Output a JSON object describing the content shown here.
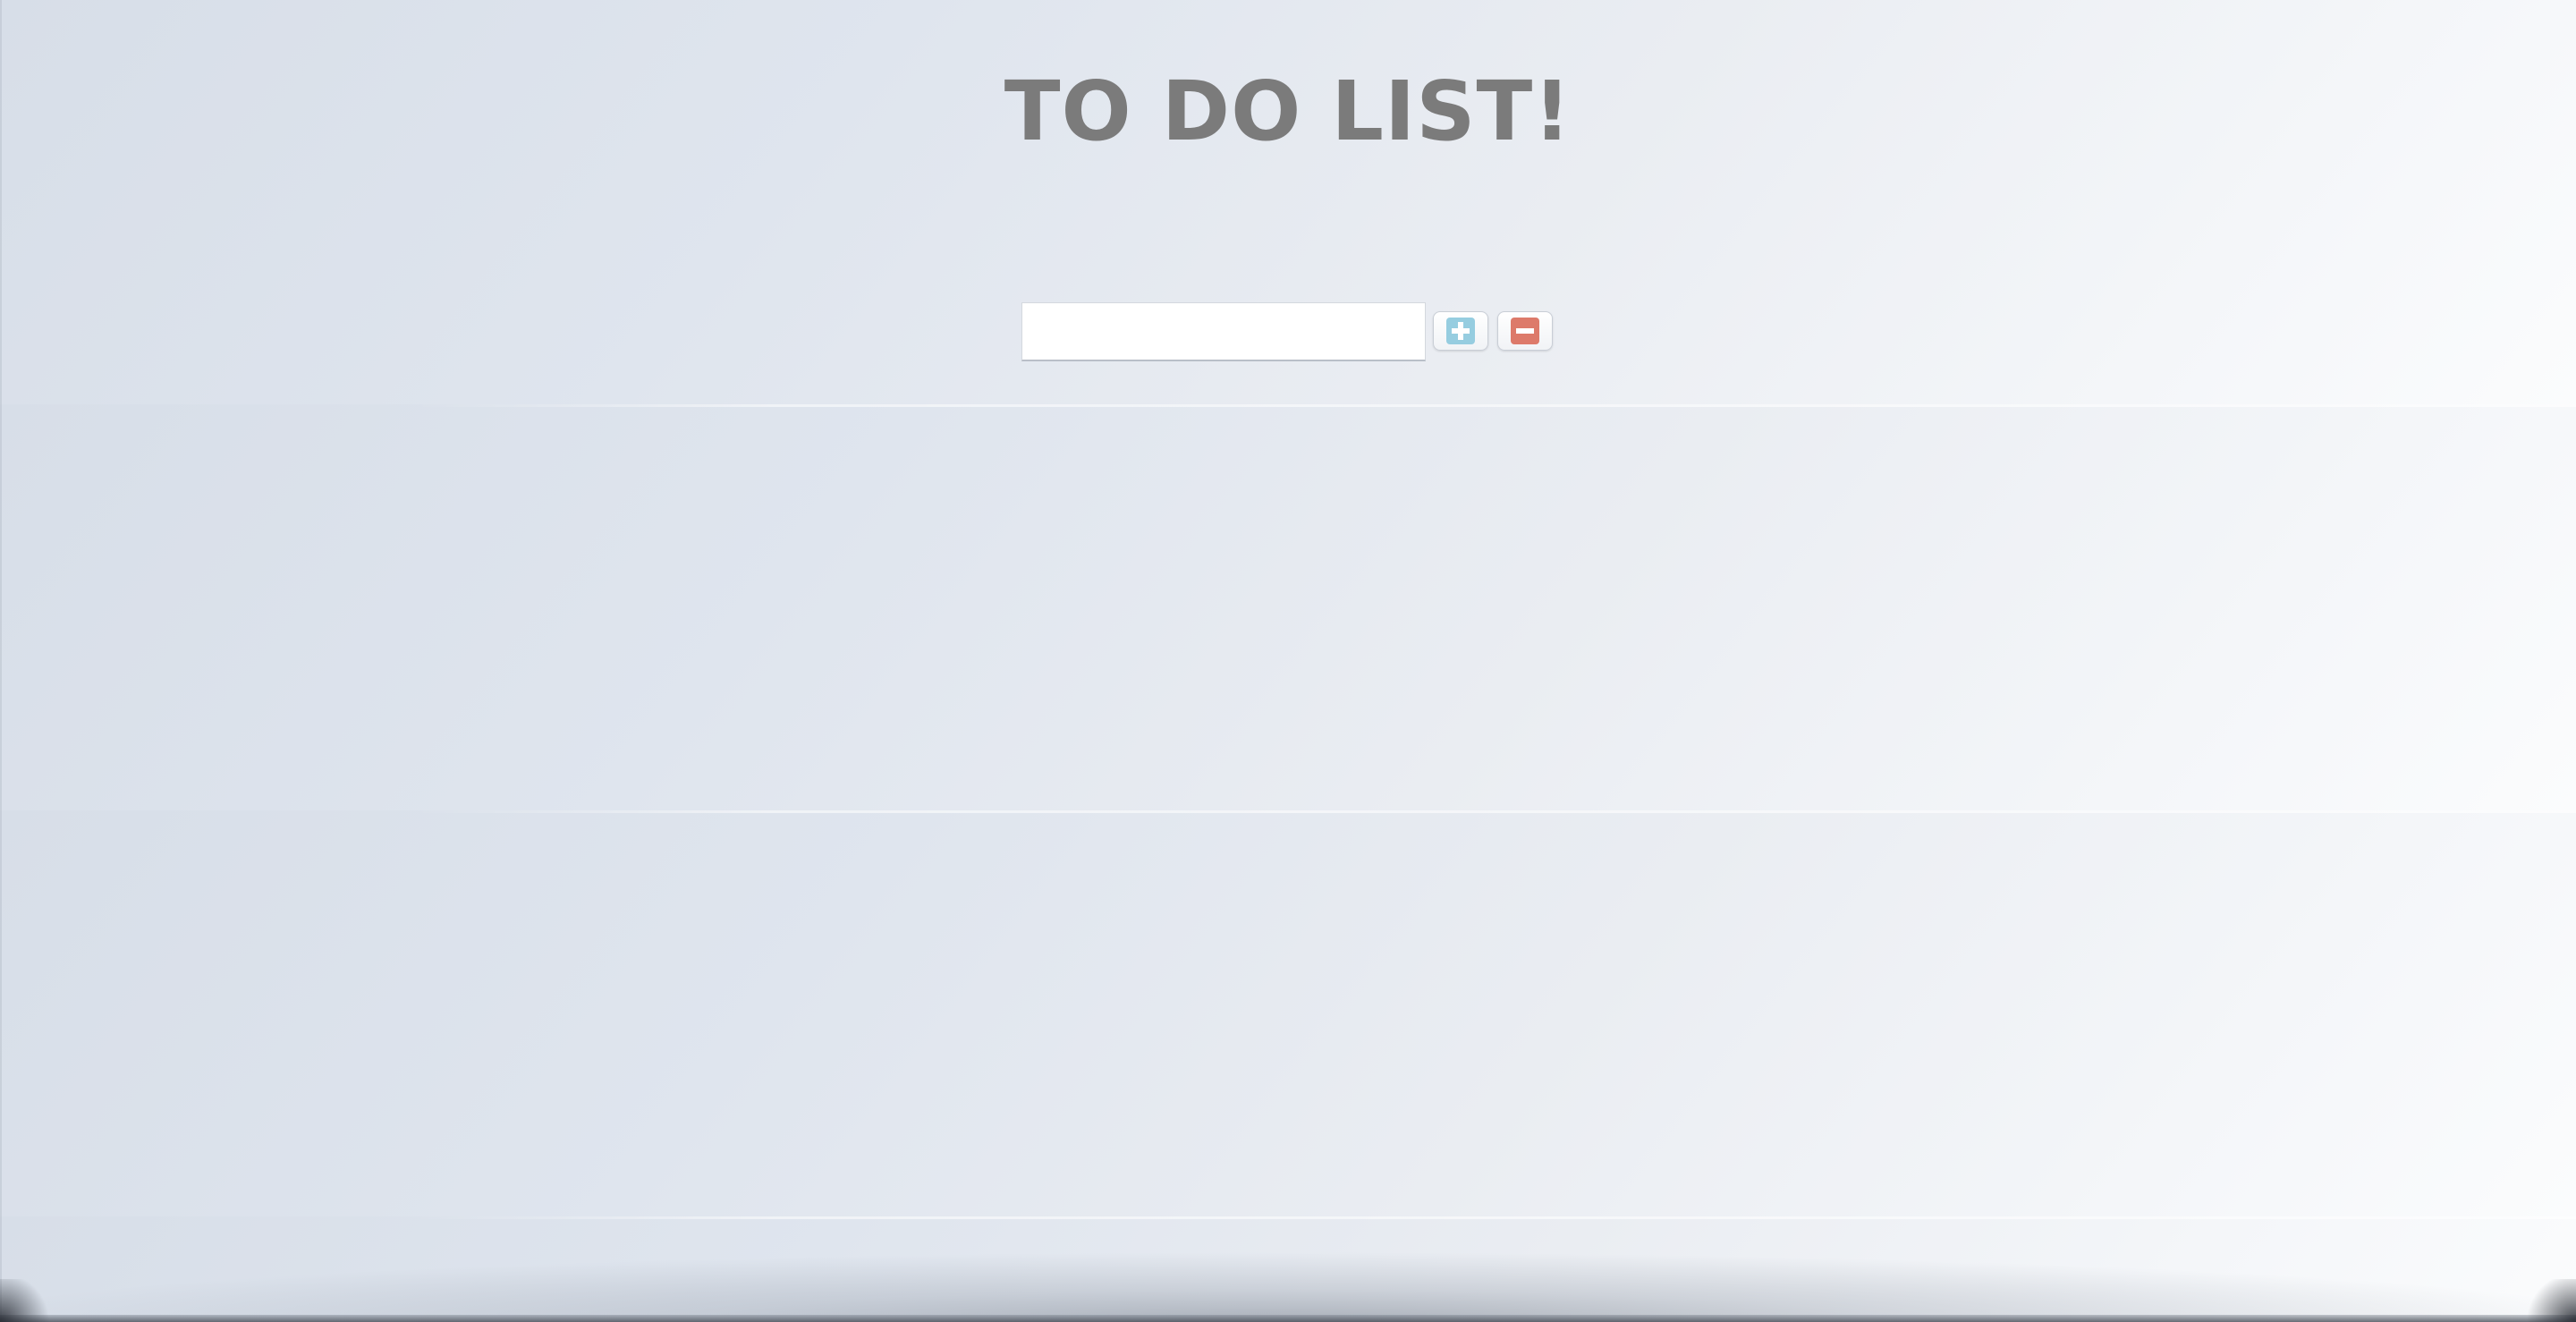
{
  "page": {
    "title": "TO DO LIST!"
  },
  "form": {
    "input_value": "",
    "input_placeholder": "",
    "add_icon": "plus-icon",
    "remove_icon": "minus-icon"
  },
  "colors": {
    "title_text": "#7b7b7b",
    "add_icon": "#96cde0",
    "remove_icon": "#dd7a6a",
    "background_start": "#d7dee8",
    "background_end": "#fbfcfd"
  }
}
